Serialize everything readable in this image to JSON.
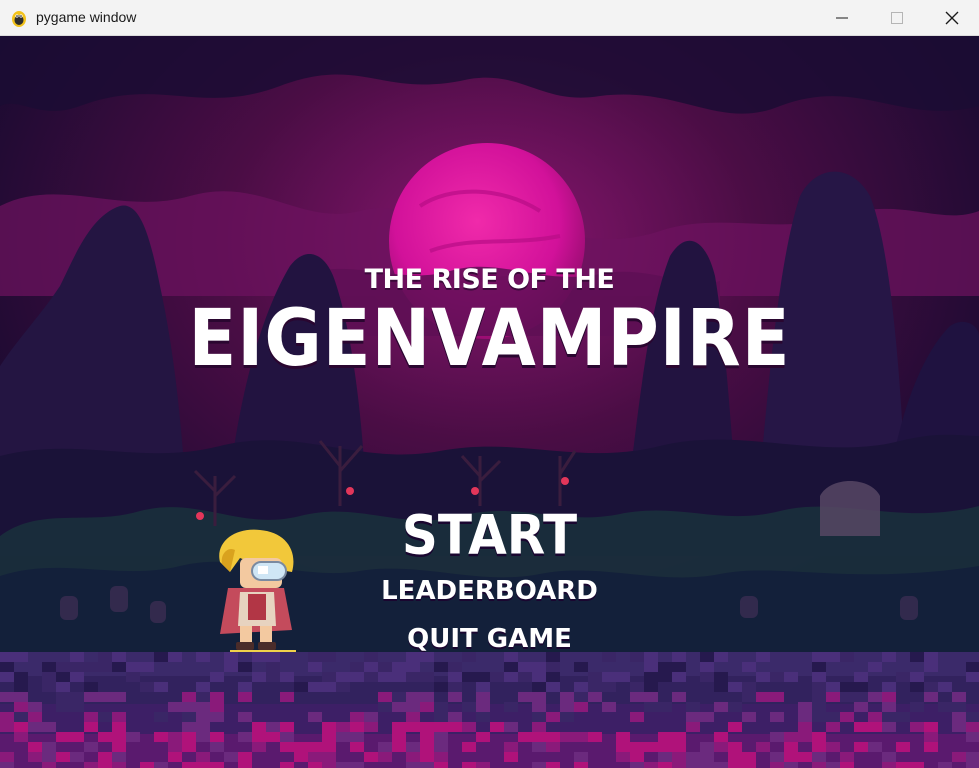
{
  "window": {
    "title": "pygame window",
    "icon": "pygame-snake-icon",
    "controls": [
      "minimize-icon",
      "maximize-icon",
      "close-icon"
    ]
  },
  "game": {
    "subtitle": "THE RISE OF THE",
    "title": "EIGENVAMPIRE",
    "menu": {
      "start": "START",
      "leaderboard": "LEADERBOARD",
      "quit": "QUIT GAME"
    },
    "scene": {
      "moon_color": "#e3139f",
      "sky_color": "#5a0f4e",
      "ground_color": "#3a2266",
      "accent_pink": "#b0127a"
    },
    "character": "blonde-hero-sprite"
  }
}
